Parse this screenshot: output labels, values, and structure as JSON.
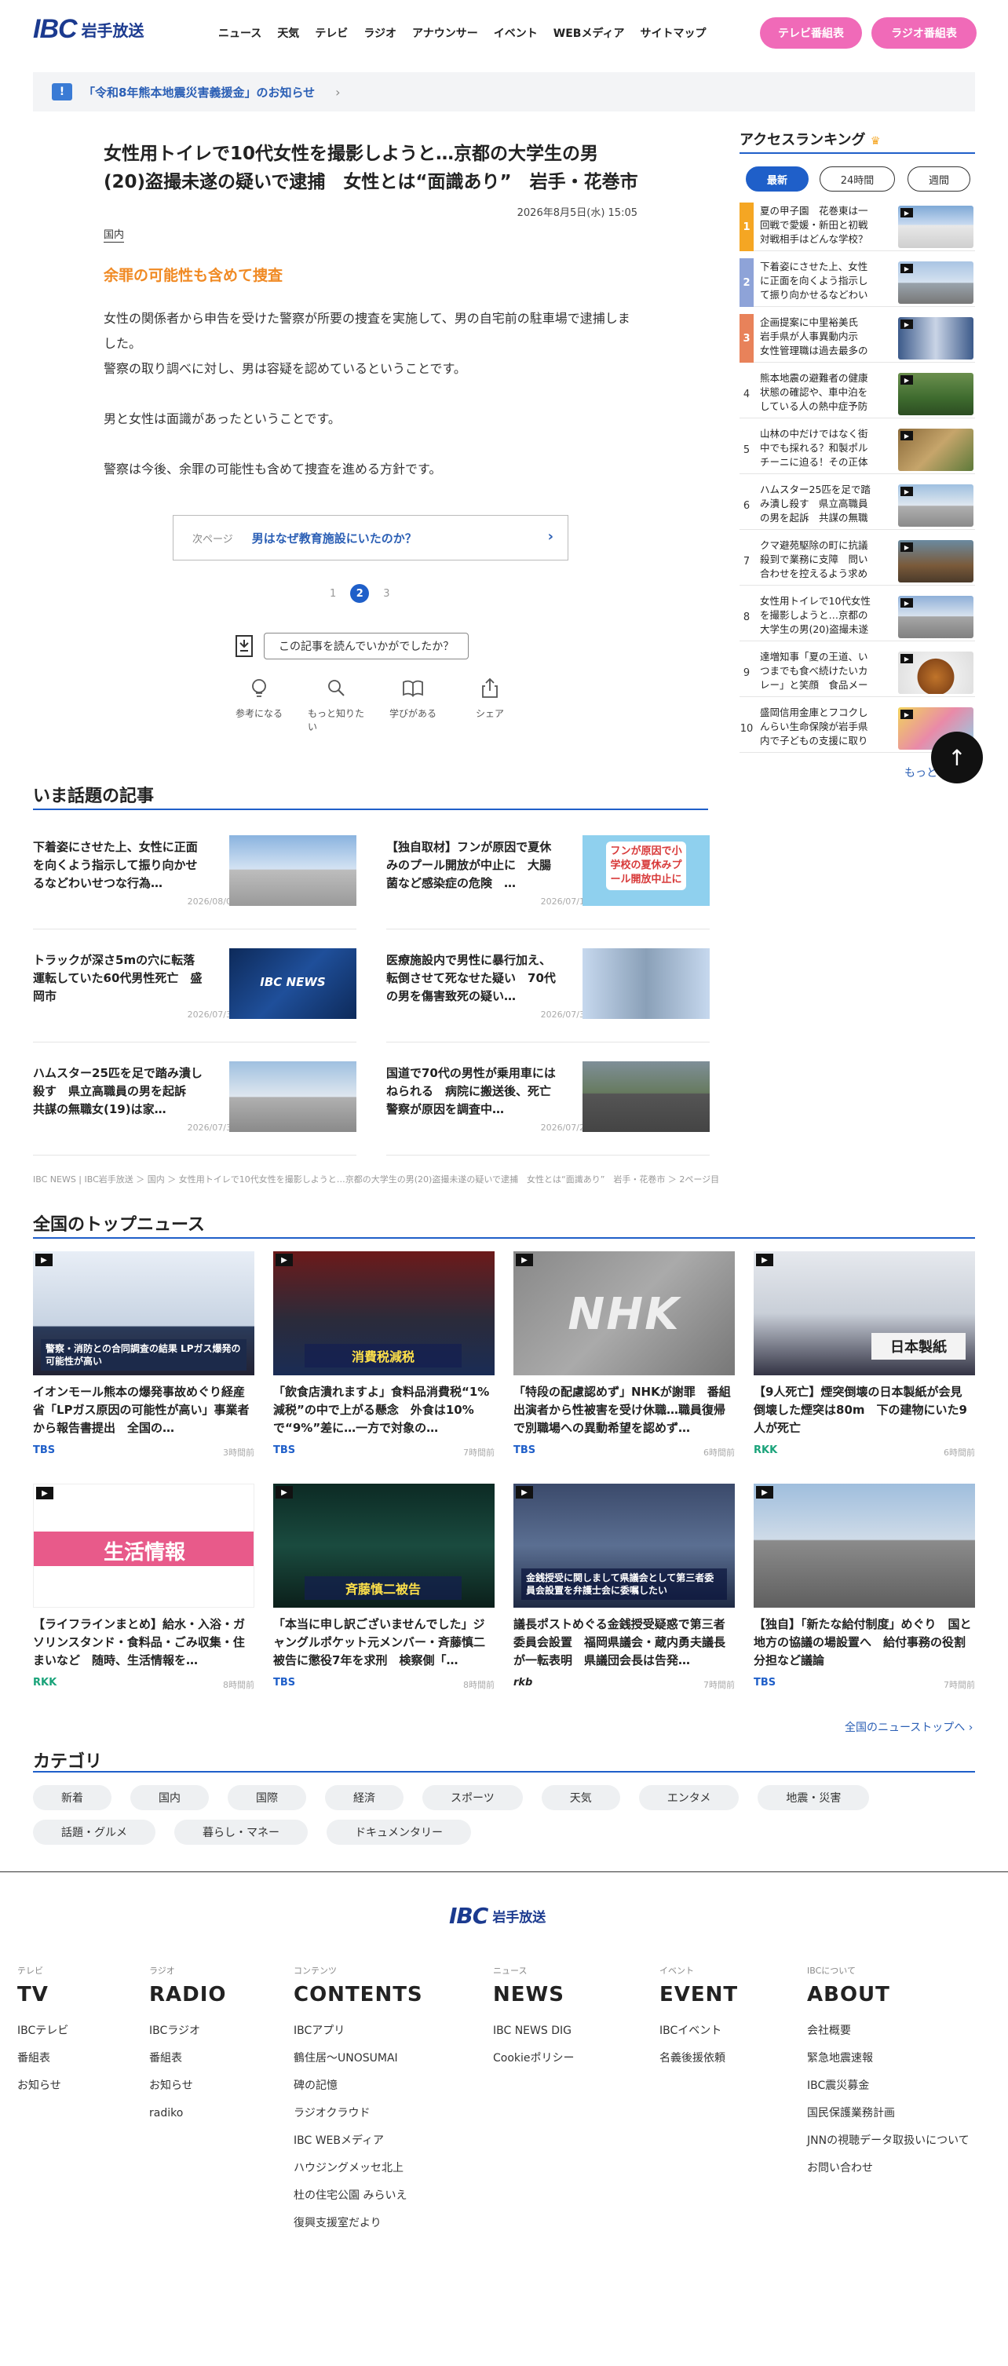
{
  "header": {
    "logo_mark": "IBC",
    "logo_name": "岩手放送",
    "nav": [
      "ニュース",
      "天気",
      "テレビ",
      "ラジオ",
      "アナウンサー",
      "イベント",
      "WEBメディア",
      "サイトマップ"
    ],
    "tv_button": "テレビ番組表",
    "radio_button": "ラジオ番組表"
  },
  "notice": {
    "icon": "!",
    "text": "「令和8年熊本地震災害義援金」のお知らせ"
  },
  "article": {
    "title": "女性用トイレで10代女性を撮影しようと…京都の大学生の男(20)盗撮未遂の疑いで逮捕　女性とは“面識あり”　岩手・花巻市",
    "date": "2026年8月5日(水) 15:05",
    "category": "国内",
    "subheading": "余罪の可能性も含めて捜査",
    "paragraphs": [
      "女性の関係者から申告を受けた警察が所要の捜査を実施して、男の自宅前の駐車場で逮捕しました。",
      "警察の取り調べに対し、男は容疑を認めているということです。",
      "男と女性は面識があったということです。",
      "警察は今後、余罪の可能性も含めて捜査を進める方針です。"
    ],
    "next_label": "次ページ",
    "next_title": "男はなぜ教育施設にいたのか？",
    "pages": [
      "1",
      "2",
      "3"
    ],
    "current_page": "2",
    "reaction_question": "この記事を読んでいかがでしたか？",
    "reactions": [
      "参考になる",
      "もっと知りたい",
      "学びがある",
      "シェア"
    ]
  },
  "ranking": {
    "title": "アクセスランキング",
    "tabs": [
      "最新",
      "24時間",
      "週間"
    ],
    "items": [
      {
        "num": "1",
        "text": "夏の甲子園　花巻東は一回戦で愛媛・新田と初戦　対戦相手はどんな学校？　岩手",
        "color": "#f5a623"
      },
      {
        "num": "2",
        "text": "下着姿にさせた上、女性に正面を向くよう指示して振り向かせるなどわいせつな行為を…",
        "color": "#8ea3d8"
      },
      {
        "num": "3",
        "text": "企画提案に中里裕美氏　岩手県が人事異動内示　女性管理職は過去最多の79人【企画理…",
        "color": "#e8825a"
      },
      {
        "num": "4",
        "text": "熊本地震の避難者の健康状態の確認や、車中泊をしている人の熱中症予防などにあたる…"
      },
      {
        "num": "5",
        "text": "山林の中だけではなく街中でも採れる？和製ポルチーニに迫る！その正体は？　岩手・…"
      },
      {
        "num": "6",
        "text": "ハムスター25匹を足で踏み潰し殺す　県立高職員の男を起訴　共謀の無職女(19)は家裁…"
      },
      {
        "num": "7",
        "text": "クマ避苑駆除の町に抗議殺到で業務に支障　問い合わせを控えるよう求める　岩手・零…"
      },
      {
        "num": "8",
        "text": "女性用トイレで10代女性を撮影しようと…京都の大学生の男(20)盗撮未遂の疑いで逮捕…"
      },
      {
        "num": "9",
        "text": "達増知事「夏の王道、いつまでも食べ続けたいカレー」と笑顔　食品メーカーとJAが考…"
      },
      {
        "num": "10",
        "text": "盛岡信用金庫とフコクしんらい生命保険が岩手県内で子どもの支援に取り組む組織に寄…"
      }
    ],
    "more": "もっと"
  },
  "hot": {
    "title": "いま話題の記事",
    "items": [
      {
        "title": "下着姿にさせた上、女性に正面を向くよう指示して振り向かせるなどわいせつな行為…",
        "date": "2026/08/03"
      },
      {
        "title": "【独自取材】フンが原因で夏休みのプール開放が中止に　大腸菌など感染症の危険　…",
        "date": "2026/07/16",
        "img_text": "フンが原因で小学校の夏休みプール開放中止に"
      },
      {
        "title": "トラックが深さ5mの穴に転落　運転していた60代男性死亡　盛岡市",
        "date": "2026/07/30",
        "img_text": "IBC NEWS"
      },
      {
        "title": "医療施設内で男性に暴行加え、転倒させて死なせた疑い　70代の男を傷害致死の疑い…",
        "date": "2026/07/30"
      },
      {
        "title": "ハムスター25匹を足で踏み潰し殺す　県立高職員の男を起訴　共謀の無職女(19)は家…",
        "date": "2026/07/30"
      },
      {
        "title": "国道で70代の男性が乗用車にはねられる　病院に搬送後、死亡　警察が原因を調査中…",
        "date": "2026/07/24"
      }
    ]
  },
  "breadcrumb": "IBC NEWS | IBC岩手放送 ＞ 国内 ＞ 女性用トイレで10代女性を撮影しようと…京都の大学生の男(20)盗撮未遂の疑いで逮捕　女性とは“面識あり”　岩手・花巻市 ＞ 2ページ目",
  "national": {
    "title": "全国のトップニュース",
    "items": [
      {
        "title": "イオンモール熊本の爆発事故めぐり経産省「LPガス原因の可能性が高い」事業者から報告書提出　全国の…",
        "source": "TBS",
        "time": "3時間前",
        "img_text": "警察・消防との合同調査の結果 LPガス爆発の可能性が高い"
      },
      {
        "title": "「飲食店潰れますよ」食料品消費税“1%減税”の中で上がる懸念　外食は10%で“9%”差に…一方で対象の…",
        "source": "TBS",
        "time": "7時間前",
        "img_text": "消費税減税"
      },
      {
        "title": "「特段の配慮認めず」NHKが謝罪　番組出演者から性被害を受け休職…職員復帰で別職場への異動希望を認めず…",
        "source": "TBS",
        "time": "6時間前",
        "img_text": "NHK"
      },
      {
        "title": "【9人死亡】煙突倒壊の日本製紙が会見　倒壊した煙突は80m　下の建物にいた9人が死亡",
        "source": "RKK",
        "time": "6時間前",
        "img_text": "日本製紙"
      },
      {
        "title": "【ライフラインまとめ】給水・入浴・ガソリンスタンド・食料品・ごみ収集・住まいなど　随時、生活情報を…",
        "source": "RKK",
        "time": "8時間前",
        "img_text": "生活情報"
      },
      {
        "title": "「本当に申し訳ございませんでした」ジャングルポケット元メンバー・斉藤慎二被告に懲役7年を求刑　検察側「…",
        "source": "TBS",
        "time": "8時間前",
        "img_text": "斉藤慎二被告"
      },
      {
        "title": "議長ポストめぐる金銭授受疑惑で第三者委員会設置　福岡県議会・蔵内勇夫議長が一転表明　県議団会長は告発…",
        "source": "rkb",
        "time": "7時間前",
        "img_text": "金銭授受に関しまして県議会として第三者委員会設置を弁護士会に委嘱したい"
      },
      {
        "title": "【独自】「新たな給付制度」めぐり　国と地方の協議の場設置へ　給付事務の役割分担など議論",
        "source": "TBS",
        "time": "7時間前"
      }
    ],
    "more": "全国のニューストップへ"
  },
  "category": {
    "title": "カテゴリ",
    "items": [
      "新着",
      "国内",
      "国際",
      "経済",
      "スポーツ",
      "天気",
      "エンタメ",
      "地震・災害",
      "話題・グルメ",
      "暮らし・マネー",
      "ドキュメンタリー"
    ]
  },
  "footer": {
    "logo_mark": "IBC",
    "logo_name": "岩手放送",
    "columns": [
      {
        "small": "テレビ",
        "big": "TV",
        "links": [
          "IBCテレビ",
          "番組表",
          "お知らせ"
        ]
      },
      {
        "small": "ラジオ",
        "big": "RADIO",
        "links": [
          "IBCラジオ",
          "番組表",
          "お知らせ",
          "radiko"
        ]
      },
      {
        "small": "コンテンツ",
        "big": "CONTENTS",
        "links": [
          "IBCアプリ",
          "鶴住居〜UNOSUMAI",
          "碑の記憶",
          "ラジオクラウド",
          "IBC WEBメディア",
          "ハウジングメッセ北上",
          "杜の住宅公園 みらいえ",
          "復興支援室だより"
        ]
      },
      {
        "small": "ニュース",
        "big": "NEWS",
        "links": [
          "IBC NEWS DIG",
          "Cookieポリシー"
        ]
      },
      {
        "small": "イベント",
        "big": "EVENT",
        "links": [
          "IBCイベント",
          "名義後援依頼"
        ]
      },
      {
        "small": "IBCについて",
        "big": "ABOUT",
        "links": [
          "会社概要",
          "緊急地震速報",
          "IBC震災募金",
          "国民保護業務計画",
          "JNNの視聴データ取扱いについて",
          "お問い合わせ"
        ]
      }
    ]
  },
  "colors": {
    "accent": "#1f5fc9",
    "pink": "#f06ab8",
    "orange": "#f08a24",
    "navy": "#1b3a8f"
  }
}
